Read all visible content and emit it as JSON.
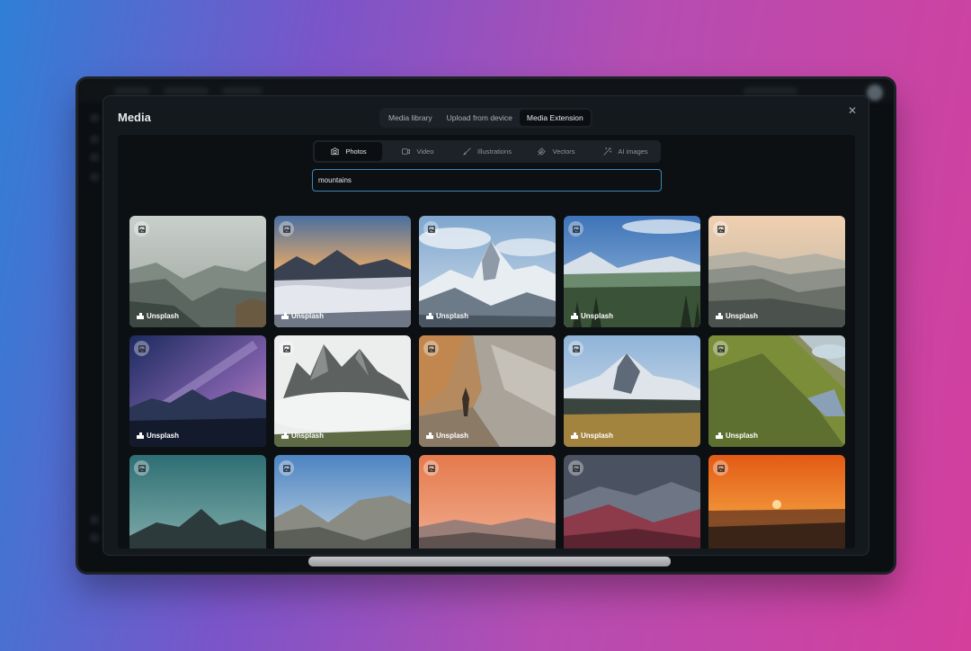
{
  "modal": {
    "title": "Media",
    "close_icon": "close-icon",
    "tabs": [
      {
        "label": "Media library",
        "active": false
      },
      {
        "label": "Upload from device",
        "active": false
      },
      {
        "label": "Media Extension",
        "active": true
      }
    ]
  },
  "type_tabs": [
    {
      "label": "Photos",
      "icon": "camera-icon",
      "active": true
    },
    {
      "label": "Video",
      "icon": "video-icon",
      "active": false
    },
    {
      "label": "Illustrations",
      "icon": "brush-icon",
      "active": false
    },
    {
      "label": "Vectors",
      "icon": "pen-tool-icon",
      "active": false
    },
    {
      "label": "AI images",
      "icon": "magic-wand-icon",
      "active": false
    }
  ],
  "search": {
    "value": "mountains"
  },
  "results": {
    "credit_label": "Unsplash",
    "items": [
      {
        "credit": "Unsplash"
      },
      {
        "credit": "Unsplash"
      },
      {
        "credit": "Unsplash"
      },
      {
        "credit": "Unsplash"
      },
      {
        "credit": "Unsplash"
      },
      {
        "credit": "Unsplash"
      },
      {
        "credit": "Unsplash"
      },
      {
        "credit": "Unsplash"
      },
      {
        "credit": "Unsplash"
      },
      {
        "credit": "Unsplash"
      },
      {
        "credit": ""
      },
      {
        "credit": ""
      },
      {
        "credit": ""
      },
      {
        "credit": ""
      },
      {
        "credit": ""
      }
    ]
  },
  "colors": {
    "accent": "#3a86b8",
    "panel": "#0d1013",
    "modal": "#14191e"
  }
}
